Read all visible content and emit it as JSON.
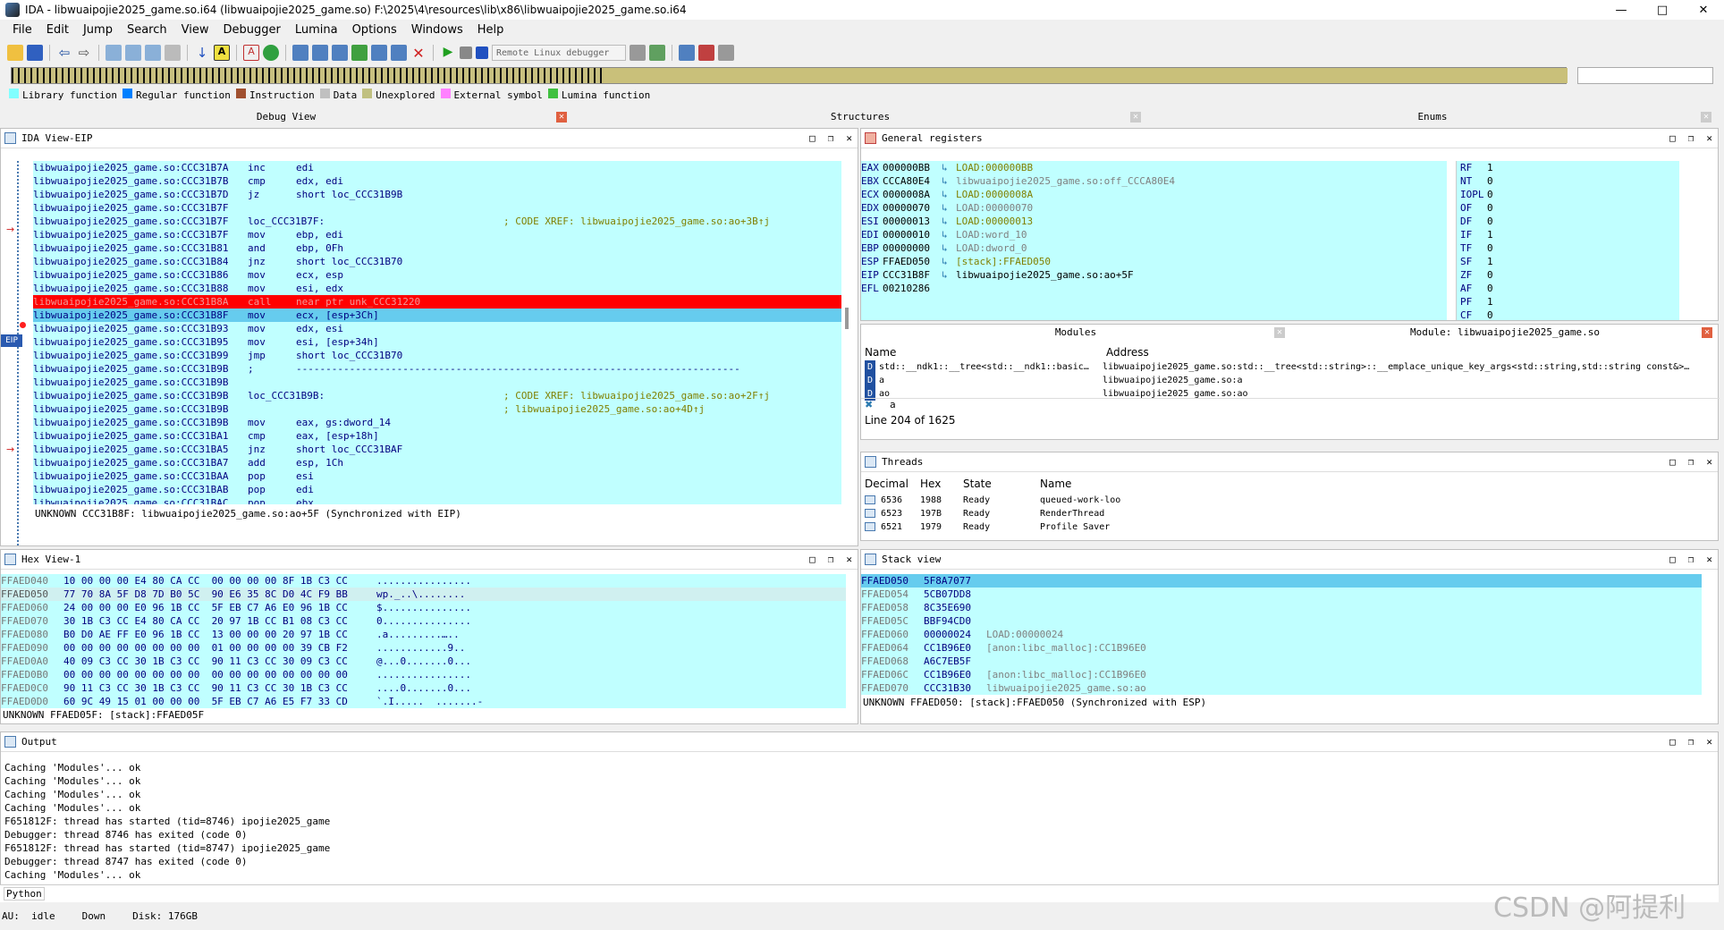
{
  "window": {
    "title": "IDA - libwuaipojie2025_game.so.i64 (libwuaipojie2025_game.so) F:\\2025\\4\\resources\\lib\\x86\\libwuaipojie2025_game.so.i64"
  },
  "menu": [
    "File",
    "Edit",
    "Jump",
    "Search",
    "View",
    "Debugger",
    "Lumina",
    "Options",
    "Windows",
    "Help"
  ],
  "toolbar": {
    "debugger_select": "Remote Linux debugger"
  },
  "legend": [
    {
      "label": "Library function",
      "color": "#80ffff"
    },
    {
      "label": "Regular function",
      "color": "#0080ff"
    },
    {
      "label": "Instruction",
      "color": "#a05030"
    },
    {
      "label": "Data",
      "color": "#c0c0c0"
    },
    {
      "label": "Unexplored",
      "color": "#c0c080"
    },
    {
      "label": "External symbol",
      "color": "#ff80ff"
    },
    {
      "label": "Lumina function",
      "color": "#40c040"
    }
  ],
  "tabs": {
    "debug_view": "Debug View",
    "structures": "Structures",
    "enums": "Enums"
  },
  "ida_view": {
    "title": "IDA View-EIP",
    "eip_label": "EIP",
    "lines": [
      {
        "addr": "libwuaipojie2025_game.so:CCC31B7A",
        "mn": "inc",
        "op": "edi",
        "cm": ""
      },
      {
        "addr": "libwuaipojie2025_game.so:CCC31B7B",
        "mn": "cmp",
        "op": "edx, edi",
        "cm": ""
      },
      {
        "addr": "libwuaipojie2025_game.so:CCC31B7D",
        "mn": "jz",
        "op": "short loc_CCC31B9B",
        "cm": ""
      },
      {
        "addr": "libwuaipojie2025_game.so:CCC31B7F",
        "mn": "",
        "op": "",
        "cm": ""
      },
      {
        "addr": "libwuaipojie2025_game.so:CCC31B7F",
        "mn": "loc_CCC31B7F:",
        "op": "",
        "cm": "; CODE XREF: libwuaipojie2025_game.so:ao+3B↑j"
      },
      {
        "addr": "libwuaipojie2025_game.so:CCC31B7F",
        "mn": "mov",
        "op": "ebp, edi",
        "cm": ""
      },
      {
        "addr": "libwuaipojie2025_game.so:CCC31B81",
        "mn": "and",
        "op": "ebp, 0Fh",
        "cm": ""
      },
      {
        "addr": "libwuaipojie2025_game.so:CCC31B84",
        "mn": "jnz",
        "op": "short loc_CCC31B70",
        "cm": ""
      },
      {
        "addr": "libwuaipojie2025_game.so:CCC31B86",
        "mn": "mov",
        "op": "ecx, esp",
        "cm": ""
      },
      {
        "addr": "libwuaipojie2025_game.so:CCC31B88",
        "mn": "mov",
        "op": "esi, edx",
        "cm": ""
      },
      {
        "addr": "libwuaipojie2025_game.so:CCC31B8A",
        "mn": "call",
        "op": "near ptr unk_CCC31220",
        "cm": ""
      },
      {
        "addr": "libwuaipojie2025_game.so:CCC31B8F",
        "mn": "mov",
        "op": "ecx, [esp+3Ch]",
        "cm": ""
      },
      {
        "addr": "libwuaipojie2025_game.so:CCC31B93",
        "mn": "mov",
        "op": "edx, esi",
        "cm": ""
      },
      {
        "addr": "libwuaipojie2025_game.so:CCC31B95",
        "mn": "mov",
        "op": "esi, [esp+34h]",
        "cm": ""
      },
      {
        "addr": "libwuaipojie2025_game.so:CCC31B99",
        "mn": "jmp",
        "op": "short loc_CCC31B70",
        "cm": ""
      },
      {
        "addr": "libwuaipojie2025_game.so:CCC31B9B",
        "mn": ";",
        "op": "---------------------------------------------------------------------------",
        "cm": ""
      },
      {
        "addr": "libwuaipojie2025_game.so:CCC31B9B",
        "mn": "",
        "op": "",
        "cm": ""
      },
      {
        "addr": "libwuaipojie2025_game.so:CCC31B9B",
        "mn": "loc_CCC31B9B:",
        "op": "",
        "cm": "; CODE XREF: libwuaipojie2025_game.so:ao+2F↑j"
      },
      {
        "addr": "libwuaipojie2025_game.so:CCC31B9B",
        "mn": "",
        "op": "",
        "cm": "; libwuaipojie2025_game.so:ao+4D↑j"
      },
      {
        "addr": "libwuaipojie2025_game.so:CCC31B9B",
        "mn": "mov",
        "op": "eax, gs:dword_14",
        "cm": ""
      },
      {
        "addr": "libwuaipojie2025_game.so:CCC31BA1",
        "mn": "cmp",
        "op": "eax, [esp+18h]",
        "cm": ""
      },
      {
        "addr": "libwuaipojie2025_game.so:CCC31BA5",
        "mn": "jnz",
        "op": "short loc_CCC31BAF",
        "cm": ""
      },
      {
        "addr": "libwuaipojie2025_game.so:CCC31BA7",
        "mn": "add",
        "op": "esp, 1Ch",
        "cm": ""
      },
      {
        "addr": "libwuaipojie2025_game.so:CCC31BAA",
        "mn": "pop",
        "op": "esi",
        "cm": ""
      },
      {
        "addr": "libwuaipojie2025_game.so:CCC31BAB",
        "mn": "pop",
        "op": "edi",
        "cm": ""
      },
      {
        "addr": "libwuaipojie2025_game.so:CCC31BAC",
        "mn": "pop",
        "op": "ebx",
        "cm": ""
      }
    ],
    "status": "UNKNOWN CCC31B8F: libwuaipojie2025_game.so:ao+5F (Synchronized with EIP)"
  },
  "registers": {
    "title": "General registers",
    "regs": [
      {
        "name": "EAX",
        "val": "000000BB",
        "ref": "LOAD:000000BB",
        "refcolor": "#808000"
      },
      {
        "name": "EBX",
        "val": "CCCA80E4",
        "ref": "libwuaipojie2025_game.so:off_CCCA80E4",
        "refcolor": "#808080"
      },
      {
        "name": "ECX",
        "val": "0000008A",
        "ref": "LOAD:0000008A",
        "refcolor": "#808000"
      },
      {
        "name": "EDX",
        "val": "00000070",
        "ref": "LOAD:00000070",
        "refcolor": "#808080"
      },
      {
        "name": "ESI",
        "val": "00000013",
        "ref": "LOAD:00000013",
        "refcolor": "#808000"
      },
      {
        "name": "EDI",
        "val": "00000010",
        "ref": "LOAD:word_10",
        "refcolor": "#808080"
      },
      {
        "name": "EBP",
        "val": "00000000",
        "ref": "LOAD:dword_0",
        "refcolor": "#808080"
      },
      {
        "name": "ESP",
        "val": "FFAED050",
        "ref": "[stack]:FFAED050",
        "refcolor": "#808000"
      },
      {
        "name": "EIP",
        "val": "CCC31B8F",
        "ref": "libwuaipojie2025_game.so:ao+5F",
        "refcolor": "#000000"
      },
      {
        "name": "EFL",
        "val": "00210286",
        "ref": "",
        "refcolor": "#000000"
      }
    ],
    "flags": [
      {
        "name": "RF",
        "val": "1"
      },
      {
        "name": "NT",
        "val": "0"
      },
      {
        "name": "IOPL",
        "val": "0"
      },
      {
        "name": "OF",
        "val": "0"
      },
      {
        "name": "DF",
        "val": "0"
      },
      {
        "name": "IF",
        "val": "1"
      },
      {
        "name": "TF",
        "val": "0"
      },
      {
        "name": "SF",
        "val": "1"
      },
      {
        "name": "ZF",
        "val": "0"
      },
      {
        "name": "AF",
        "val": "0"
      },
      {
        "name": "PF",
        "val": "1"
      },
      {
        "name": "CF",
        "val": "0"
      }
    ]
  },
  "modules": {
    "tab_modules": "Modules",
    "tab_module": "Module: libwuaipojie2025_game.so",
    "col_name": "Name",
    "col_address": "Address",
    "rows": [
      {
        "name": "std::__ndk1::__tree<std::__ndk1::basic…",
        "addr": "libwuaipojie2025_game.so:std::__tree<std::string>::__emplace_unique_key_args<std::string,std::string const&>…"
      },
      {
        "name": "a",
        "addr": "libwuaipojie2025_game.so:a"
      },
      {
        "name": "ao",
        "addr": "libwuaipojie2025_game.so:ao"
      }
    ],
    "filter": "a",
    "line_info": "Line 204 of 1625"
  },
  "threads": {
    "title": "Threads",
    "cols": [
      "Decimal",
      "Hex",
      "State",
      "Name"
    ],
    "rows": [
      {
        "dec": "6536",
        "hex": "1988",
        "state": "Ready",
        "name": "queued-work-loo"
      },
      {
        "dec": "6523",
        "hex": "197B",
        "state": "Ready",
        "name": "RenderThread"
      },
      {
        "dec": "6521",
        "hex": "1979",
        "state": "Ready",
        "name": "Profile Saver"
      }
    ]
  },
  "hex": {
    "title": "Hex View-1",
    "rows": [
      {
        "addr": "FFAED040",
        "bytes": "10 00 00 00 E4 80 CA CC  00 00 00 00 8F 1B C3 CC",
        "ascii": "................"
      },
      {
        "addr": "FFAED050",
        "bytes": "77 70 8A 5F D8 7D B0 5C  90 E6 35 8C D0 4C F9 BB",
        "ascii": "wp._..\\........"
      },
      {
        "addr": "FFAED060",
        "bytes": "24 00 00 00 E0 96 1B CC  5F EB C7 A6 E0 96 1B CC",
        "ascii": "$..............."
      },
      {
        "addr": "FFAED070",
        "bytes": "30 1B C3 CC E4 80 CA CC  20 97 1B CC B1 08 C3 CC",
        "ascii": "0..............."
      },
      {
        "addr": "FFAED080",
        "bytes": "B0 D0 AE FF E0 96 1B CC  13 00 00 00 20 97 1B CC",
        "ascii": ".а.........….."
      },
      {
        "addr": "FFAED090",
        "bytes": "00 00 00 00 00 00 00 00  01 00 00 00 00 39 CB F2",
        "ascii": "............9.."
      },
      {
        "addr": "FFAED0A0",
        "bytes": "40 09 C3 CC 30 1B C3 CC  90 11 C3 CC 30 09 C3 CC",
        "ascii": "@...0.......0..."
      },
      {
        "addr": "FFAED0B0",
        "bytes": "00 00 00 00 00 00 00 00  00 00 00 00 00 00 00 00",
        "ascii": "................"
      },
      {
        "addr": "FFAED0C0",
        "bytes": "90 11 C3 CC 30 1B C3 CC  90 11 C3 CC 30 1B C3 CC",
        "ascii": "....0.......0..."
      },
      {
        "addr": "FFAED0D0",
        "bytes": "60 9C 49 15 01 00 00 00  5F EB C7 A6 E5 F7 33 CD",
        "ascii": "`.I.....  .......-"
      }
    ],
    "status": "UNKNOWN FFAED05F: [stack]:FFAED05F"
  },
  "stack": {
    "title": "Stack view",
    "rows": [
      {
        "addr": "FFAED050",
        "val": "5F8A7077",
        "ref": ""
      },
      {
        "addr": "FFAED054",
        "val": "5CB07DD8",
        "ref": ""
      },
      {
        "addr": "FFAED058",
        "val": "8C35E690",
        "ref": ""
      },
      {
        "addr": "FFAED05C",
        "val": "BBF94CD0",
        "ref": ""
      },
      {
        "addr": "FFAED060",
        "val": "00000024",
        "ref": "LOAD:00000024"
      },
      {
        "addr": "FFAED064",
        "val": "CC1B96E0",
        "ref": "[anon:libc_malloc]:CC1B96E0"
      },
      {
        "addr": "FFAED068",
        "val": "A6C7EB5F",
        "ref": ""
      },
      {
        "addr": "FFAED06C",
        "val": "CC1B96E0",
        "ref": "[anon:libc_malloc]:CC1B96E0"
      },
      {
        "addr": "FFAED070",
        "val": "CCC31B30",
        "ref": "libwuaipojie2025_game.so:ao"
      }
    ],
    "status": "UNKNOWN FFAED050: [stack]:FFAED050 (Synchronized with ESP)"
  },
  "output": {
    "title": "Output",
    "lines": [
      "Caching 'Modules'... ok",
      "Caching 'Modules'... ok",
      "Caching 'Modules'... ok",
      "Caching 'Modules'... ok",
      "F651812F: thread has started (tid=8746) ipojie2025_game",
      "Debugger: thread 8746 has exited (code 0)",
      "F651812F: thread has started (tid=8747) ipojie2025_game",
      "Debugger: thread 8747 has exited (code 0)",
      "Caching 'Modules'... ok"
    ],
    "python_label": "Python"
  },
  "statusbar": {
    "au_label": "AU:",
    "au_state": "idle",
    "direction": "Down",
    "disk": "Disk: 176GB"
  },
  "watermark": "CSDN @阿提利"
}
